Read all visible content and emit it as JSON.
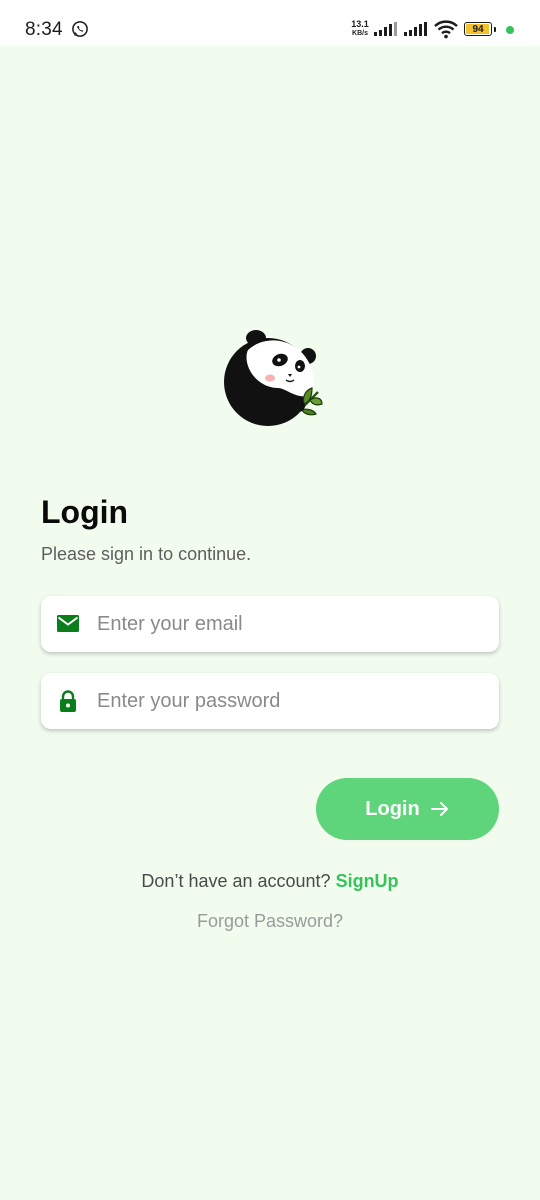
{
  "status_bar": {
    "time": "8:34",
    "net_speed_value": "13.1",
    "net_speed_unit": "KB/s",
    "battery_level": "94",
    "battery_fraction": 0.94,
    "battery_color": "#f3c12b",
    "indicator_color": "#36c45a"
  },
  "icons": {
    "notification": "whatsapp-icon",
    "signal_1": "signal-icon",
    "signal_2": "signal-icon",
    "wifi": "wifi-icon",
    "battery": "battery-icon",
    "logo": "panda-logo",
    "email": "mail-icon",
    "password": "lock-icon",
    "login": "arrow-right-icon"
  },
  "login": {
    "title": "Login",
    "subtitle": "Please sign in to continue.",
    "email_placeholder": "Enter your email",
    "email_value": "",
    "password_placeholder": "Enter your password",
    "password_value": "",
    "button_label": "Login",
    "signup_prompt": "Don’t have an account? ",
    "signup_link": "SignUp",
    "forgot_password": "Forgot Password?"
  },
  "colors": {
    "background": "#f1fcef",
    "accent": "#36c45a",
    "button": "#5ed47b",
    "icon_green": "#0a7e1a"
  }
}
